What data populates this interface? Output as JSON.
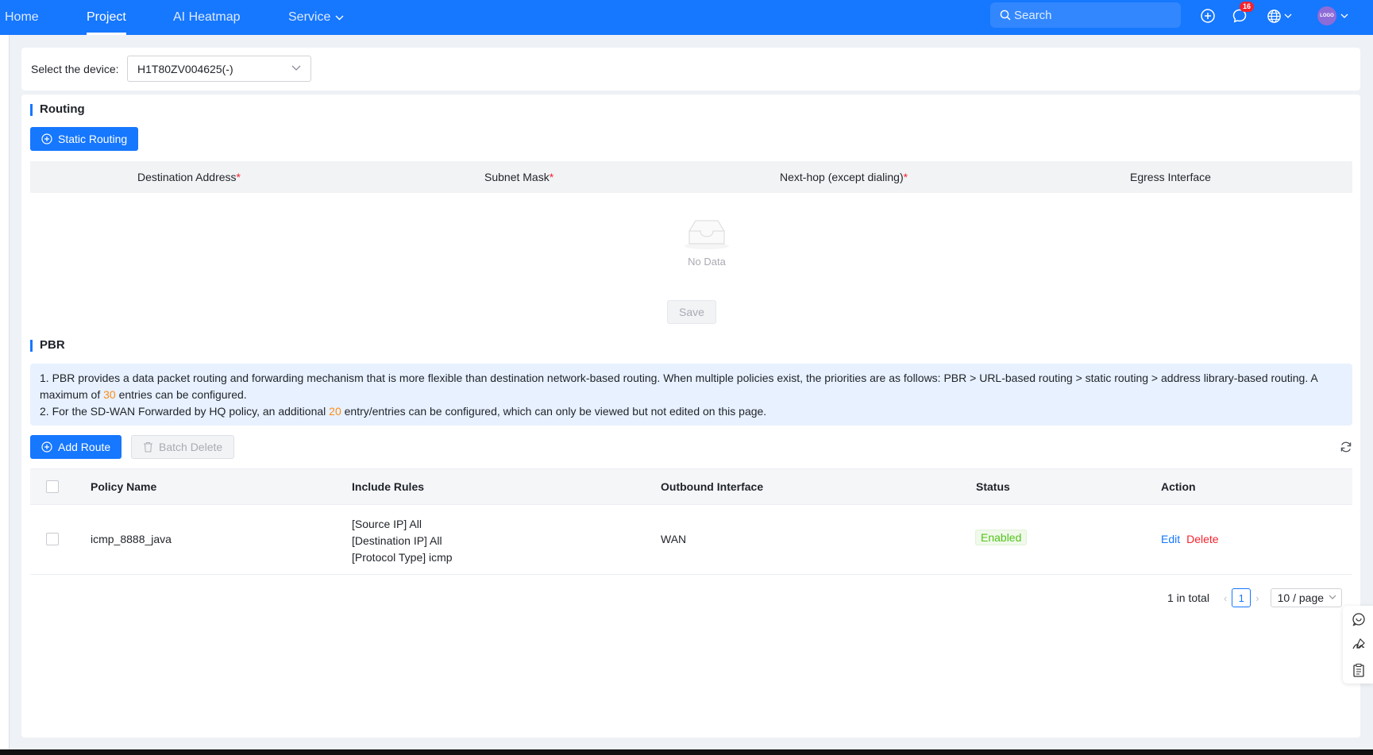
{
  "nav": {
    "home": "Home",
    "project": "Project",
    "heatmap": "AI Heatmap",
    "service": "Service",
    "search_placeholder": "Search",
    "notification_count": "16",
    "avatar_text": "LOGO"
  },
  "device": {
    "label": "Select the device:",
    "value": "H1T80ZV004625(-)"
  },
  "routing": {
    "title": "Routing",
    "add_button": "Static Routing",
    "columns": {
      "destination": "Destination Address",
      "subnet": "Subnet Mask",
      "nexthop": "Next-hop (except dialing)",
      "egress": "Egress Interface",
      "required_mark": "*"
    },
    "empty_text": "No Data",
    "save_button": "Save"
  },
  "pbr": {
    "title": "PBR",
    "info": {
      "line1_a": "1. PBR provides a data packet routing and forwarding mechanism that is more flexible than destination network-based routing. When multiple policies exist, the priorities are as follows: PBR > URL-based routing > static routing > address library-based routing. A maximum of ",
      "line1_num": "30",
      "line1_b": " entries can be configured.",
      "line2_a": "2. For the SD-WAN Forwarded by HQ policy, an additional ",
      "line2_num": "20",
      "line2_b": " entry/entries can be configured, which can only be viewed but not edited on this page."
    },
    "add_button": "Add Route",
    "batch_delete_button": "Batch Delete",
    "columns": {
      "policy_name": "Policy Name",
      "include_rules": "Include Rules",
      "outbound": "Outbound Interface",
      "status": "Status",
      "action": "Action"
    },
    "rows": [
      {
        "policy_name": "icmp_8888_java",
        "rule1": "[Source IP] All",
        "rule2": "[Destination IP] All",
        "rule3": "[Protocol Type] icmp",
        "outbound": "WAN",
        "status": "Enabled",
        "edit": "Edit",
        "delete": "Delete"
      }
    ],
    "pagination": {
      "total": "1 in total",
      "current_page": "1",
      "page_size": "10 / page"
    }
  },
  "colors": {
    "primary": "#1677ff",
    "danger": "#f5222d",
    "success": "#52c41a",
    "highlight": "#fa8c16"
  }
}
